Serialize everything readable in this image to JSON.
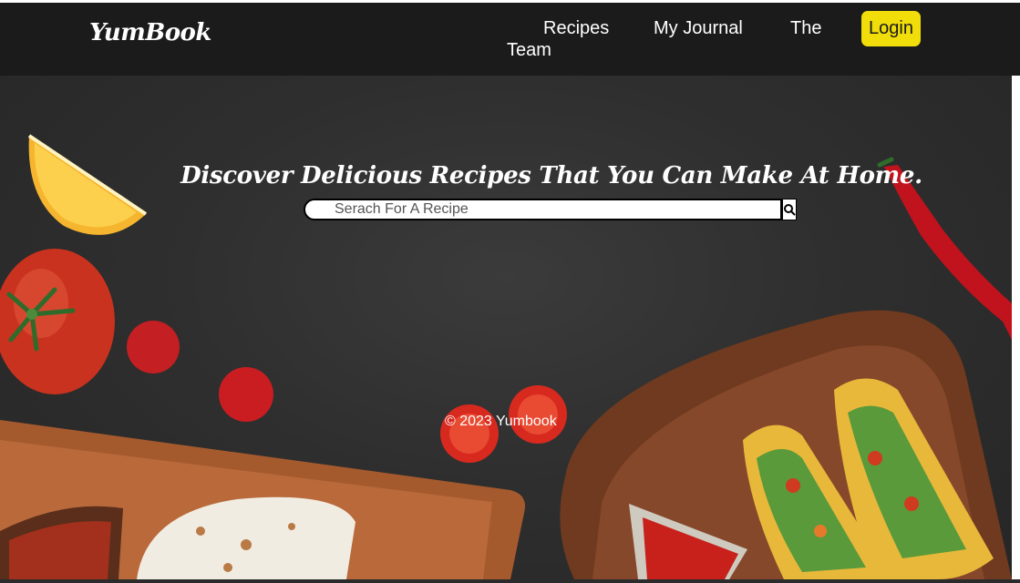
{
  "brand": {
    "logo_text": "YumBook"
  },
  "nav": {
    "recipes": "Recipes",
    "journal": "My Journal",
    "team_part1": "The",
    "team_part2": "Team",
    "login": "Login"
  },
  "hero": {
    "headline": "Discover Delicious Recipes That You Can Make At Home.",
    "search_placeholder": "Serach For A Recipe",
    "search_icon": "search-icon"
  },
  "footer": {
    "copyright": "© 2023 Yumbook"
  },
  "colors": {
    "nav_bg": "#1b1b1b",
    "login_bg": "#f0dd0a",
    "hero_bg": "#2f2f2f"
  }
}
